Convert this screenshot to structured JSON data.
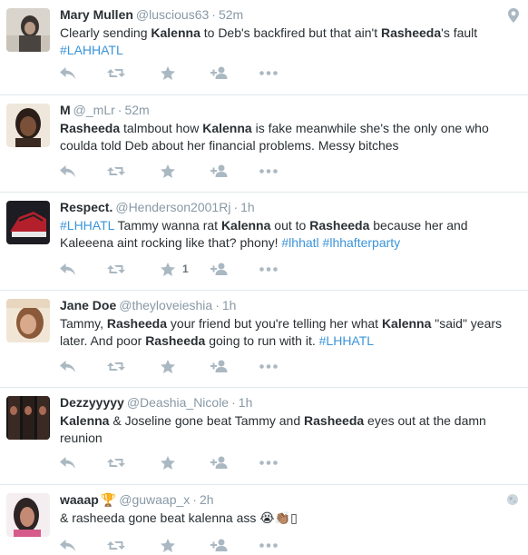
{
  "colors": {
    "name": "#292f33",
    "meta": "#8899a6",
    "hashtag": "#3b94d9",
    "action": "#aab8c2",
    "divider": "#e1e8ed"
  },
  "tweets": [
    {
      "name": "Mary Mullen",
      "handle": "@luscious63",
      "time": "52m",
      "text_parts": [
        {
          "t": "Clearly sending ",
          "s": "n"
        },
        {
          "t": "Kalenna",
          "s": "b"
        },
        {
          "t": " to Deb's backfired but that ain't ",
          "s": "n"
        },
        {
          "t": "Rasheeda",
          "s": "b"
        },
        {
          "t": "'s fault ",
          "s": "n"
        },
        {
          "t": "#LAHHATL",
          "s": "h"
        }
      ],
      "favorite_count": "",
      "corner_icon": "location-pin-icon"
    },
    {
      "name": "M",
      "handle": "@_mLr",
      "time": "52m",
      "text_parts": [
        {
          "t": "Rasheeda",
          "s": "b"
        },
        {
          "t": " talmbout how ",
          "s": "n"
        },
        {
          "t": "Kalenna",
          "s": "b"
        },
        {
          "t": " is fake meanwhile she's the only one who coulda told Deb about her financial problems. Messy bitches",
          "s": "n"
        }
      ],
      "favorite_count": ""
    },
    {
      "name": "Respect.",
      "handle": "@Henderson2001Rj",
      "time": "1h",
      "text_parts": [
        {
          "t": "#LHHATL",
          "s": "h"
        },
        {
          "t": " Tammy wanna rat ",
          "s": "n"
        },
        {
          "t": "Kalenna",
          "s": "b"
        },
        {
          "t": " out to ",
          "s": "n"
        },
        {
          "t": "Rasheeda",
          "s": "b"
        },
        {
          "t": " because her and Kaleeena aint rocking like that? phony! ",
          "s": "n"
        },
        {
          "t": "#lhhatl",
          "s": "h"
        },
        {
          "t": " ",
          "s": "n"
        },
        {
          "t": "#lhhafterparty",
          "s": "h"
        }
      ],
      "favorite_count": "1"
    },
    {
      "name": "Jane Doe",
      "handle": "@theyloveieshia",
      "time": "1h",
      "text_parts": [
        {
          "t": "Tammy, ",
          "s": "n"
        },
        {
          "t": "Rasheeda",
          "s": "b"
        },
        {
          "t": " your friend but you're telling her what ",
          "s": "n"
        },
        {
          "t": "Kalenna",
          "s": "b"
        },
        {
          "t": " \"said\" years later. And poor ",
          "s": "n"
        },
        {
          "t": "Rasheeda",
          "s": "b"
        },
        {
          "t": " going to run with it. ",
          "s": "n"
        },
        {
          "t": "#LHHATL",
          "s": "h"
        }
      ],
      "favorite_count": ""
    },
    {
      "name": "Dezzyyyyy",
      "handle": "@Deashia_Nicole",
      "time": "1h",
      "text_parts": [
        {
          "t": "Kalenna",
          "s": "b"
        },
        {
          "t": " & Joseline gone beat Tammy and ",
          "s": "n"
        },
        {
          "t": "Rasheeda",
          "s": "b"
        },
        {
          "t": " eyes out at the damn reunion",
          "s": "n"
        }
      ],
      "favorite_count": ""
    },
    {
      "name": "waaap",
      "name_suffix": "🏆",
      "handle": "@guwaap_x",
      "time": "2h",
      "text_parts": [
        {
          "t": "& rasheeda gone beat kalenna ass ",
          "s": "n"
        },
        {
          "t": "😭👏🏽▯",
          "s": "n"
        }
      ],
      "favorite_count": "",
      "corner_icon": "globe-icon"
    }
  ]
}
